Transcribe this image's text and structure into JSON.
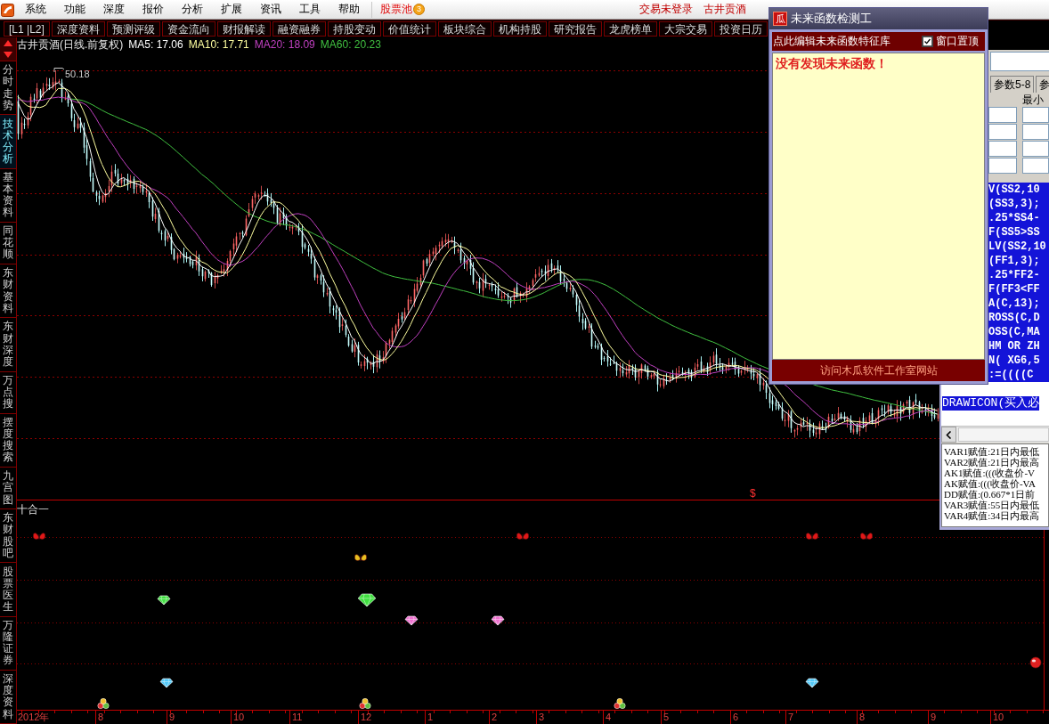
{
  "menu_bar": {
    "items": [
      "系统",
      "功能",
      "深度",
      "报价",
      "分析",
      "扩展",
      "资讯",
      "工具",
      "帮助"
    ],
    "stock_pool": {
      "label": "股票池",
      "badge": "3"
    },
    "login_status": "交易未登录",
    "stock_name": "古井贡酒"
  },
  "toolbar": {
    "tabs": [
      "[L1 |L2]",
      "深度资料",
      "预测评级",
      "资金流向",
      "财报解读",
      "融资融券",
      "持股变动",
      "价值统计",
      "板块综合",
      "机构持股",
      "研究报告",
      "龙虎榜单",
      "大宗交易",
      "投资日历"
    ]
  },
  "chart_header": {
    "title": "古井贡酒(日线.前复权)",
    "indicators": [
      {
        "label": "MA5: 17.06",
        "color": "#ffffff"
      },
      {
        "label": "MA10: 17.71",
        "color": "#ffffa0"
      },
      {
        "label": "MA20: 18.09",
        "color": "#c040c0"
      },
      {
        "label": "MA60: 20.23",
        "color": "#40c040"
      }
    ]
  },
  "sidebar": {
    "tabs": [
      {
        "label": "分时走势",
        "selected": false
      },
      {
        "label": "技术分析",
        "selected": true
      },
      {
        "label": "基本资料",
        "selected": false
      },
      {
        "label": "同花顺",
        "selected": false
      },
      {
        "label": "东财资料",
        "selected": false
      },
      {
        "label": "东财深度",
        "selected": false
      },
      {
        "label": "万点搜",
        "selected": false
      },
      {
        "label": "摆度搜索",
        "selected": false
      },
      {
        "label": "九宫图",
        "selected": false
      },
      {
        "label": "东财股吧",
        "selected": false
      },
      {
        "label": "股票医生",
        "selected": false
      },
      {
        "label": "万隆证券",
        "selected": false
      },
      {
        "label": "深度资料",
        "selected": false
      }
    ]
  },
  "main_chart": {
    "high_label": "50.18",
    "signal_mark": "$"
  },
  "lower_panel": {
    "title": "十合一"
  },
  "time_axis": {
    "labels": [
      "2012年",
      "8",
      "9",
      "10",
      "11",
      "12",
      "1",
      "2",
      "3",
      "4",
      "5",
      "6",
      "7",
      "8",
      "9",
      "10"
    ]
  },
  "check_window": {
    "app_icon": "瓜",
    "title": "未来函数检测工",
    "edit_link": "点此编辑未来函数特征库",
    "pin": {
      "label": "窗口置顶",
      "checked": true
    },
    "result": "没有发现未来函数！",
    "footer_link": "访问木瓜软件工作室网站"
  },
  "formula_window": {
    "param_tabs": [
      {
        "label": "参数5-8",
        "selected": false
      },
      {
        "label": "参",
        "selected": false
      }
    ],
    "column_header": "最小",
    "code_lines": [
      "V(SS2,10",
      "(SS3,3);",
      ".25*SS4-",
      "F(SS5>SS",
      "LV(SS2,10",
      "(FF1,3);",
      ".25*FF2-",
      "F(FF3<FF",
      "A(C,13);",
      "ROSS(C,D",
      "OSS(C,MA",
      "HM OR ZH",
      "N( XG6,5",
      ":=((((C"
    ],
    "lower_code_line": "DRAWICON(买入必",
    "output_lines": [
      "VAR1赋值:21日内最低",
      "VAR2赋值:21日内最高",
      "AK1赋值:(((收盘价-V",
      "AK赋值:(((收盘价-VA",
      "DD赋值:(0.667*1日前",
      "VAR3赋值:55日内最低",
      "VAR4赋值:34日内最高"
    ]
  }
}
